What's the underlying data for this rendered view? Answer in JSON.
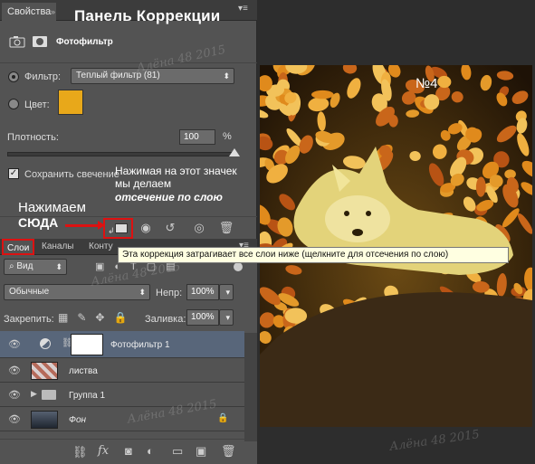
{
  "properties_panel": {
    "tab_label": "Свойства",
    "tab_close": "»",
    "overlay_title": "Панель Коррекции",
    "adjustment_name": "Фотофильтр",
    "filter_label": "Фильтр:",
    "filter_value": "Теплый фильтр (81)",
    "color_label": "Цвет:",
    "color_swatch": "#e8a81a",
    "density_label": "Плотность:",
    "density_value": "100",
    "density_unit": "%",
    "preserve_label": "Сохранить свечение"
  },
  "annotations": {
    "clip_hint_line1": "Нажимая на этот значек",
    "clip_hint_line2": "мы делаем",
    "clip_hint_line3": "отсечение по слою",
    "press_line1": "Нажимаем",
    "press_line2": "СЮДА"
  },
  "tooltip": "Эта коррекция затрагивает все слои ниже (щелкните для отсечения по слою)",
  "layers_panel": {
    "tabs": [
      "Слои",
      "Каналы",
      "Конту"
    ],
    "kind_label": "Вид",
    "blend_mode": "Обычные",
    "opacity_label": "Непр:",
    "opacity_value": "100%",
    "lock_label": "Закрепить:",
    "fill_label": "Заливка:",
    "fill_value": "100%",
    "layers": [
      {
        "name": "Фотофильтр 1",
        "selected": true
      },
      {
        "name": "листва",
        "selected": false
      },
      {
        "name": "Группа 1",
        "selected": false
      },
      {
        "name": "Фон",
        "selected": false,
        "locked": true
      }
    ],
    "footer_fx": "fx"
  },
  "canvas": {
    "label": "№4"
  },
  "watermark": "Алёна 48 2015",
  "colors": {
    "panel_bg": "#535353",
    "selected_layer": "#58667a",
    "highlight_red": "#dd1111"
  }
}
